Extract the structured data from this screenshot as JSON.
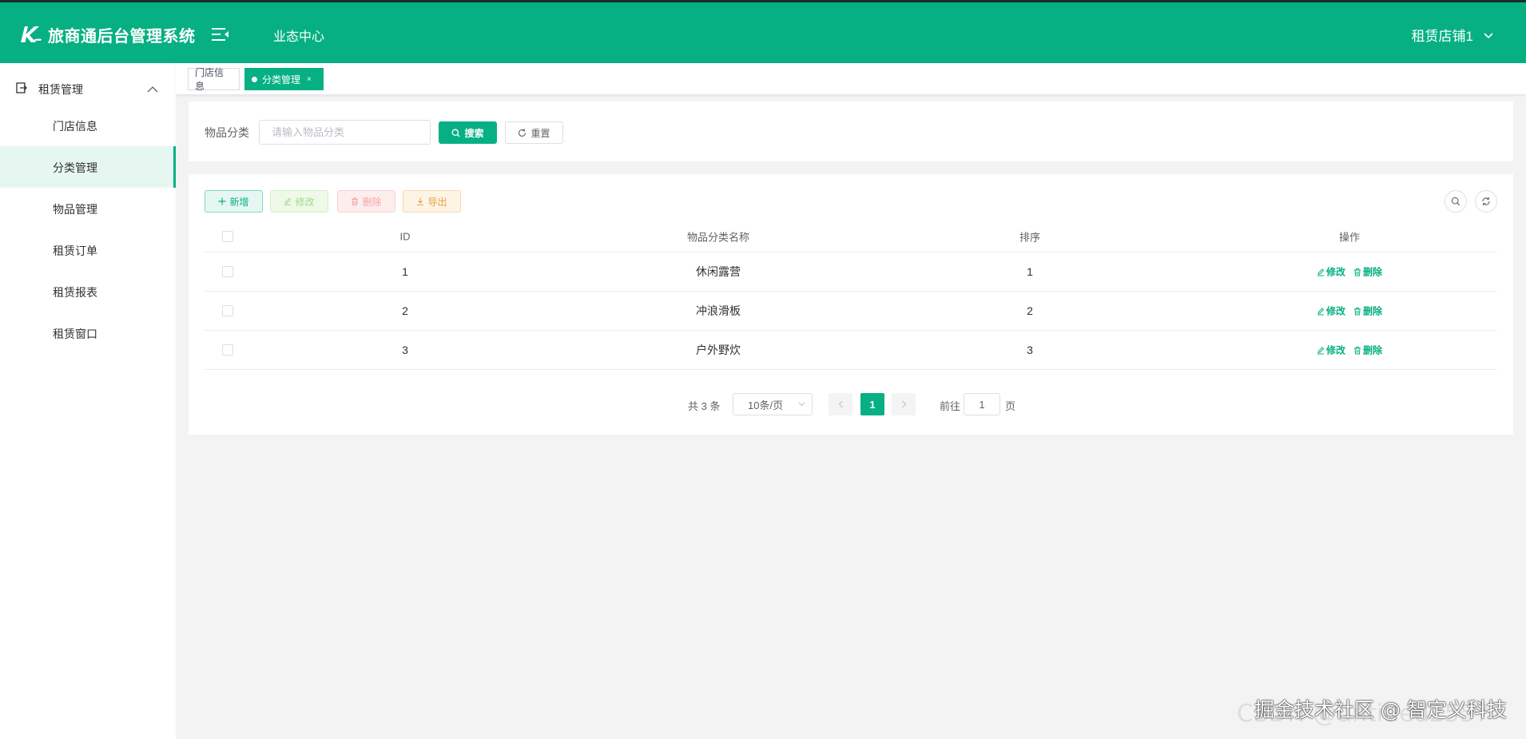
{
  "header": {
    "app_title": "旅商通后台管理系统",
    "nav_item": "业态中心",
    "store_name": "租赁店铺1"
  },
  "sidebar": {
    "group_label": "租赁管理",
    "items": [
      {
        "label": "门店信息"
      },
      {
        "label": "分类管理"
      },
      {
        "label": "物品管理"
      },
      {
        "label": "租赁订单"
      },
      {
        "label": "租赁报表"
      },
      {
        "label": "租赁窗口"
      }
    ],
    "active_index": 1
  },
  "tags": {
    "items": [
      {
        "label": "门店信息"
      },
      {
        "label": "分类管理",
        "close": "×"
      }
    ]
  },
  "search": {
    "label": "物品分类",
    "placeholder": "请输入物品分类",
    "value": "",
    "search_btn": "搜索",
    "reset_btn": "重置"
  },
  "toolbar": {
    "add": "新增",
    "edit": "修改",
    "delete": "删除",
    "export": "导出"
  },
  "table": {
    "columns": {
      "id": "ID",
      "name": "物品分类名称",
      "sort": "排序",
      "op": "操作"
    },
    "rows": [
      {
        "id": "1",
        "name": "休闲露营",
        "sort": "1"
      },
      {
        "id": "2",
        "name": "冲浪滑板",
        "sort": "2"
      },
      {
        "id": "3",
        "name": "户外野炊",
        "sort": "3"
      }
    ],
    "op_edit": "修改",
    "op_delete": "删除"
  },
  "pagination": {
    "total_text": "共 3 条",
    "page_size": "10条/页",
    "current_page": "1",
    "goto_label": "前往",
    "goto_value": "1",
    "page_suffix": "页"
  },
  "watermark": {
    "text": "掘金技术社区 @ 智定义科技",
    "ghost": "CSDN @untitled2557"
  },
  "colors": {
    "brand": "#06b083",
    "header_text": "#ffffff",
    "active_menu_bg": "#e6f7f2"
  }
}
